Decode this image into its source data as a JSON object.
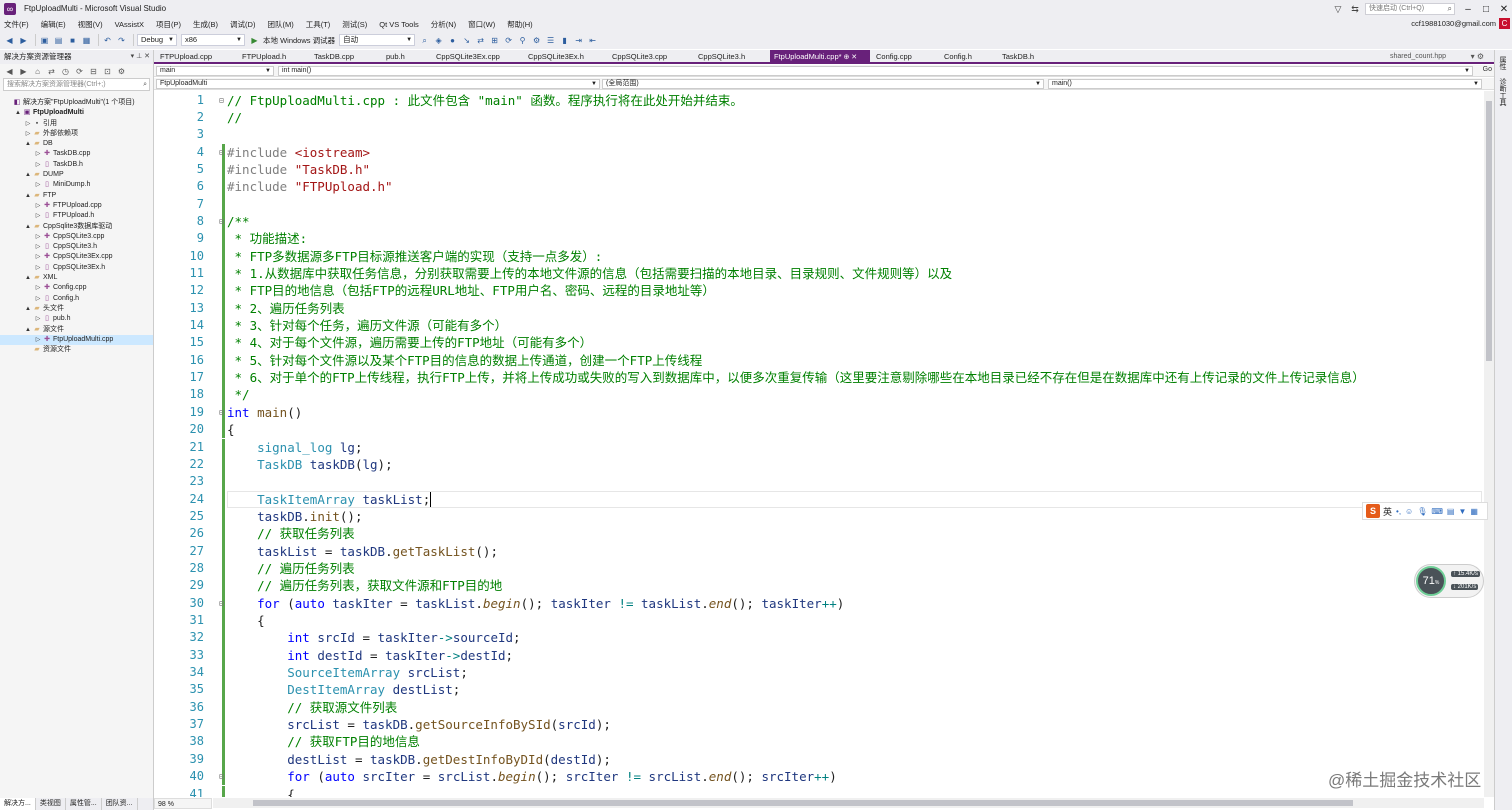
{
  "window": {
    "title": "FtpUploadMulti - Microsoft Visual Studio",
    "quick_launch": "快速启动 (Ctrl+Q)",
    "user": "ccf19881030@gmail.com",
    "user_badge": "C"
  },
  "menu": [
    "文件(F)",
    "编辑(E)",
    "视图(V)",
    "VAssistX",
    "项目(P)",
    "生成(B)",
    "调试(D)",
    "团队(M)",
    "工具(T)",
    "测试(S)",
    "Qt VS Tools",
    "分析(N)",
    "窗口(W)",
    "帮助(H)"
  ],
  "toolbar": {
    "config": "Debug",
    "platform": "x86",
    "debugger": "本地 Windows 调试器",
    "auto": "自动"
  },
  "solution_explorer": {
    "title": "解决方案资源管理器",
    "search_placeholder": "搜索解决方案资源管理器(Ctrl+;)",
    "items": [
      {
        "depth": 0,
        "expander": "",
        "icon": "sln",
        "label": "解决方案\"FtpUploadMulti\"(1 个项目)"
      },
      {
        "depth": 1,
        "expander": "▲",
        "icon": "proj",
        "label": "FtpUploadMulti",
        "bold": true
      },
      {
        "depth": 2,
        "expander": "▷",
        "icon": "ref",
        "label": "引用"
      },
      {
        "depth": 2,
        "expander": "▷",
        "icon": "folder",
        "label": "外部依赖项"
      },
      {
        "depth": 2,
        "expander": "▲",
        "icon": "folder",
        "label": "DB"
      },
      {
        "depth": 3,
        "expander": "▷",
        "icon": "cpp",
        "label": "TaskDB.cpp"
      },
      {
        "depth": 3,
        "expander": "▷",
        "icon": "h",
        "label": "TaskDB.h"
      },
      {
        "depth": 2,
        "expander": "▲",
        "icon": "folder",
        "label": "DUMP"
      },
      {
        "depth": 3,
        "expander": "▷",
        "icon": "h",
        "label": "MiniDump.h"
      },
      {
        "depth": 2,
        "expander": "▲",
        "icon": "folder",
        "label": "FTP"
      },
      {
        "depth": 3,
        "expander": "▷",
        "icon": "cpp",
        "label": "FTPUpload.cpp"
      },
      {
        "depth": 3,
        "expander": "▷",
        "icon": "h",
        "label": "FTPUpload.h"
      },
      {
        "depth": 2,
        "expander": "▲",
        "icon": "folder",
        "label": "CppSqlite3数据库驱动"
      },
      {
        "depth": 3,
        "expander": "▷",
        "icon": "cpp",
        "label": "CppSQLite3.cpp"
      },
      {
        "depth": 3,
        "expander": "▷",
        "icon": "h",
        "label": "CppSQLite3.h"
      },
      {
        "depth": 3,
        "expander": "▷",
        "icon": "cpp",
        "label": "CppSQLite3Ex.cpp"
      },
      {
        "depth": 3,
        "expander": "▷",
        "icon": "h",
        "label": "CppSQLite3Ex.h"
      },
      {
        "depth": 2,
        "expander": "▲",
        "icon": "folder",
        "label": "XML"
      },
      {
        "depth": 3,
        "expander": "▷",
        "icon": "cpp",
        "label": "Config.cpp"
      },
      {
        "depth": 3,
        "expander": "▷",
        "icon": "h",
        "label": "Config.h"
      },
      {
        "depth": 2,
        "expander": "▲",
        "icon": "folder",
        "label": "头文件"
      },
      {
        "depth": 3,
        "expander": "▷",
        "icon": "h",
        "label": "pub.h"
      },
      {
        "depth": 2,
        "expander": "▲",
        "icon": "folder",
        "label": "源文件"
      },
      {
        "depth": 3,
        "expander": "▷",
        "icon": "cpp",
        "label": "FtpUploadMulti.cpp",
        "selected": true
      },
      {
        "depth": 2,
        "expander": "",
        "icon": "folder",
        "label": "资源文件"
      }
    ],
    "bottom_tabs": [
      "解决方...",
      "类视图",
      "属性管...",
      "团队资..."
    ]
  },
  "tabs": [
    {
      "label": "FTPUpload.cpp",
      "active": false
    },
    {
      "label": "FTPUpload.h",
      "active": false
    },
    {
      "label": "TaskDB.cpp",
      "active": false
    },
    {
      "label": "pub.h",
      "active": false
    },
    {
      "label": "CppSQLite3Ex.cpp",
      "active": false
    },
    {
      "label": "CppSQLite3Ex.h",
      "active": false
    },
    {
      "label": "CppSQLite3.cpp",
      "active": false
    },
    {
      "label": "CppSQLite3.h",
      "active": false
    },
    {
      "label": "FtpUploadMulti.cpp*",
      "active": true
    },
    {
      "label": "Config.cpp",
      "active": false
    },
    {
      "label": "Config.h",
      "active": false
    },
    {
      "label": "TaskDB.h",
      "active": false
    }
  ],
  "shared_tab": "shared_count.hpp",
  "nav": {
    "scope": "main",
    "member": "int main()",
    "project": "FtpUploadMulti",
    "global": "(全局范围)",
    "func": "main()",
    "go": "Go"
  },
  "editor": {
    "zoom": "98 %",
    "lines": [
      {
        "n": "1",
        "t": [
          [
            "c-com",
            "// FtpUploadMulti.cpp : 此文件包含 \"main\" 函数。程序执行将在此处开始并结束。"
          ]
        ],
        "fold": "-"
      },
      {
        "n": "2",
        "t": [
          [
            "c-com",
            "//"
          ]
        ]
      },
      {
        "n": "3",
        "t": []
      },
      {
        "n": "4",
        "t": [
          [
            "c-pre",
            "#include "
          ],
          [
            "c-str",
            "<iostream>"
          ]
        ],
        "fold": "-"
      },
      {
        "n": "5",
        "t": [
          [
            "c-pre",
            "#include "
          ],
          [
            "c-str",
            "\"TaskDB.h\""
          ]
        ]
      },
      {
        "n": "6",
        "t": [
          [
            "c-pre",
            "#include "
          ],
          [
            "c-str",
            "\"FTPUpload.h\""
          ]
        ]
      },
      {
        "n": "7",
        "t": []
      },
      {
        "n": "8",
        "t": [
          [
            "c-com",
            "/**"
          ]
        ],
        "fold": "-"
      },
      {
        "n": "9",
        "t": [
          [
            "c-com",
            " * 功能描述:"
          ]
        ]
      },
      {
        "n": "10",
        "t": [
          [
            "c-com",
            " * FTP多数据源多FTP目标源推送客户端的实现（支持一点多发）:"
          ]
        ]
      },
      {
        "n": "11",
        "t": [
          [
            "c-com",
            " * 1.从数据库中获取任务信息，分别获取需要上传的本地文件源的信息（包括需要扫描的本地目录、目录规则、文件规则等）以及"
          ]
        ]
      },
      {
        "n": "12",
        "t": [
          [
            "c-com",
            " * FTP目的地信息（包括FTP的远程URL地址、FTP用户名、密码、远程的目录地址等）"
          ]
        ]
      },
      {
        "n": "13",
        "t": [
          [
            "c-com",
            " * 2、遍历任务列表"
          ]
        ]
      },
      {
        "n": "14",
        "t": [
          [
            "c-com",
            " * 3、针对每个任务，遍历文件源（可能有多个）"
          ]
        ]
      },
      {
        "n": "15",
        "t": [
          [
            "c-com",
            " * 4、对于每个文件源，遍历需要上传的FTP地址（可能有多个）"
          ]
        ]
      },
      {
        "n": "16",
        "t": [
          [
            "c-com",
            " * 5、针对每个文件源以及某个FTP目的信息的数据上传通道，创建一个FTP上传线程"
          ]
        ]
      },
      {
        "n": "17",
        "t": [
          [
            "c-com",
            " * 6、对于单个的FTP上传线程，执行FTP上传，并将上传成功或失败的写入到数据库中，以便多次重复传输（这里要注意剔除哪些在本地目录已经不存在但是在数据库中还有上传记录的文件上传记录信息）"
          ]
        ]
      },
      {
        "n": "18",
        "t": [
          [
            "c-com",
            " */"
          ]
        ]
      },
      {
        "n": "19",
        "t": [
          [
            "c-kw",
            "int "
          ],
          [
            "c-fn",
            "main"
          ],
          [
            "",
            "()"
          ]
        ],
        "fold": "-"
      },
      {
        "n": "20",
        "t": [
          [
            "",
            "{"
          ]
        ]
      },
      {
        "n": "21",
        "t": [
          [
            "",
            "    "
          ],
          [
            "c-ty",
            "signal_log "
          ],
          [
            "c-var",
            "lg"
          ],
          [
            "",
            ";"
          ]
        ]
      },
      {
        "n": "22",
        "t": [
          [
            "",
            "    "
          ],
          [
            "c-ty",
            "TaskDB "
          ],
          [
            "c-var",
            "taskDB"
          ],
          [
            "",
            "("
          ],
          [
            "c-var",
            "lg"
          ],
          [
            "",
            ");"
          ]
        ]
      },
      {
        "n": "23",
        "t": []
      },
      {
        "n": "24",
        "t": [
          [
            "",
            "    "
          ],
          [
            "c-ty",
            "TaskItemArray "
          ],
          [
            "c-var",
            "taskList"
          ],
          [
            "",
            ";"
          ]
        ],
        "current": true
      },
      {
        "n": "25",
        "t": [
          [
            "",
            "    "
          ],
          [
            "c-var",
            "taskDB"
          ],
          [
            "",
            "."
          ],
          [
            "c-fn",
            "init"
          ],
          [
            "",
            "();"
          ]
        ]
      },
      {
        "n": "26",
        "t": [
          [
            "",
            "    "
          ],
          [
            "c-com",
            "// 获取任务列表"
          ]
        ]
      },
      {
        "n": "27",
        "t": [
          [
            "",
            "    "
          ],
          [
            "c-var",
            "taskList"
          ],
          [
            "",
            " = "
          ],
          [
            "c-var",
            "taskDB"
          ],
          [
            "",
            "."
          ],
          [
            "c-fn",
            "getTaskList"
          ],
          [
            "",
            "();"
          ]
        ]
      },
      {
        "n": "28",
        "t": [
          [
            "",
            "    "
          ],
          [
            "c-com",
            "// 遍历任务列表"
          ]
        ]
      },
      {
        "n": "29",
        "t": [
          [
            "",
            "    "
          ],
          [
            "c-com",
            "// 遍历任务列表，获取文件源和FTP目的地"
          ]
        ]
      },
      {
        "n": "30",
        "t": [
          [
            "",
            "    "
          ],
          [
            "c-kw",
            "for "
          ],
          [
            "",
            "("
          ],
          [
            "c-kw",
            "auto "
          ],
          [
            "c-var",
            "taskIter"
          ],
          [
            "",
            " = "
          ],
          [
            "c-var",
            "taskList"
          ],
          [
            "",
            "."
          ],
          [
            "c-fni",
            "begin"
          ],
          [
            "",
            "(); "
          ],
          [
            "c-var",
            "taskIter"
          ],
          [
            "",
            " "
          ],
          [
            "c-op",
            "!="
          ],
          [
            "",
            " "
          ],
          [
            "c-var",
            "taskList"
          ],
          [
            "",
            "."
          ],
          [
            "c-fni",
            "end"
          ],
          [
            "",
            "(); "
          ],
          [
            "c-var",
            "taskIter"
          ],
          [
            "c-op",
            "++"
          ],
          [
            "",
            ")"
          ]
        ],
        "fold": "-"
      },
      {
        "n": "31",
        "t": [
          [
            "",
            "    {"
          ]
        ]
      },
      {
        "n": "32",
        "t": [
          [
            "",
            "        "
          ],
          [
            "c-kw",
            "int "
          ],
          [
            "c-var",
            "srcId"
          ],
          [
            "",
            " = "
          ],
          [
            "c-var",
            "taskIter"
          ],
          [
            "c-op",
            "->"
          ],
          [
            "c-var",
            "sourceId"
          ],
          [
            "",
            ";"
          ]
        ]
      },
      {
        "n": "33",
        "t": [
          [
            "",
            "        "
          ],
          [
            "c-kw",
            "int "
          ],
          [
            "c-var",
            "destId"
          ],
          [
            "",
            " = "
          ],
          [
            "c-var",
            "taskIter"
          ],
          [
            "c-op",
            "->"
          ],
          [
            "c-var",
            "destId"
          ],
          [
            "",
            ";"
          ]
        ]
      },
      {
        "n": "34",
        "t": [
          [
            "",
            "        "
          ],
          [
            "c-ty",
            "SourceItemArray "
          ],
          [
            "c-var",
            "srcList"
          ],
          [
            "",
            ";"
          ]
        ]
      },
      {
        "n": "35",
        "t": [
          [
            "",
            "        "
          ],
          [
            "c-ty",
            "DestItemArray "
          ],
          [
            "c-var",
            "destList"
          ],
          [
            "",
            ";"
          ]
        ]
      },
      {
        "n": "36",
        "t": [
          [
            "",
            "        "
          ],
          [
            "c-com",
            "// 获取源文件列表"
          ]
        ]
      },
      {
        "n": "37",
        "t": [
          [
            "",
            "        "
          ],
          [
            "c-var",
            "srcList"
          ],
          [
            "",
            " = "
          ],
          [
            "c-var",
            "taskDB"
          ],
          [
            "",
            "."
          ],
          [
            "c-fn",
            "getSourceInfoBySId"
          ],
          [
            "",
            "("
          ],
          [
            "c-var",
            "srcId"
          ],
          [
            "",
            ");"
          ]
        ]
      },
      {
        "n": "38",
        "t": [
          [
            "",
            "        "
          ],
          [
            "c-com",
            "// 获取FTP目的地信息"
          ]
        ]
      },
      {
        "n": "39",
        "t": [
          [
            "",
            "        "
          ],
          [
            "c-var",
            "destList"
          ],
          [
            "",
            " = "
          ],
          [
            "c-var",
            "taskDB"
          ],
          [
            "",
            "."
          ],
          [
            "c-fn",
            "getDestInfoByDId"
          ],
          [
            "",
            "("
          ],
          [
            "c-var",
            "destId"
          ],
          [
            "",
            ");"
          ]
        ]
      },
      {
        "n": "40",
        "t": [
          [
            "",
            "        "
          ],
          [
            "c-kw",
            "for "
          ],
          [
            "",
            "("
          ],
          [
            "c-kw",
            "auto "
          ],
          [
            "c-var",
            "srcIter"
          ],
          [
            "",
            " = "
          ],
          [
            "c-var",
            "srcList"
          ],
          [
            "",
            "."
          ],
          [
            "c-fni",
            "begin"
          ],
          [
            "",
            "(); "
          ],
          [
            "c-var",
            "srcIter"
          ],
          [
            "",
            " "
          ],
          [
            "c-op",
            "!="
          ],
          [
            "",
            " "
          ],
          [
            "c-var",
            "srcList"
          ],
          [
            "",
            "."
          ],
          [
            "c-fni",
            "end"
          ],
          [
            "",
            "(); "
          ],
          [
            "c-var",
            "srcIter"
          ],
          [
            "c-op",
            "++"
          ],
          [
            "",
            ")"
          ]
        ],
        "fold": "-"
      },
      {
        "n": "41",
        "t": [
          [
            "",
            "        {"
          ]
        ]
      }
    ]
  },
  "ime": {
    "logo": "S",
    "lang": "英"
  },
  "net_widget": {
    "percent": "71",
    "pct_sign": "%",
    "up": "15.4K/s",
    "down": "201K/s"
  },
  "right_strip": [
    "属性",
    "诊断工具"
  ],
  "watermark": "@稀土掘金技术社区"
}
